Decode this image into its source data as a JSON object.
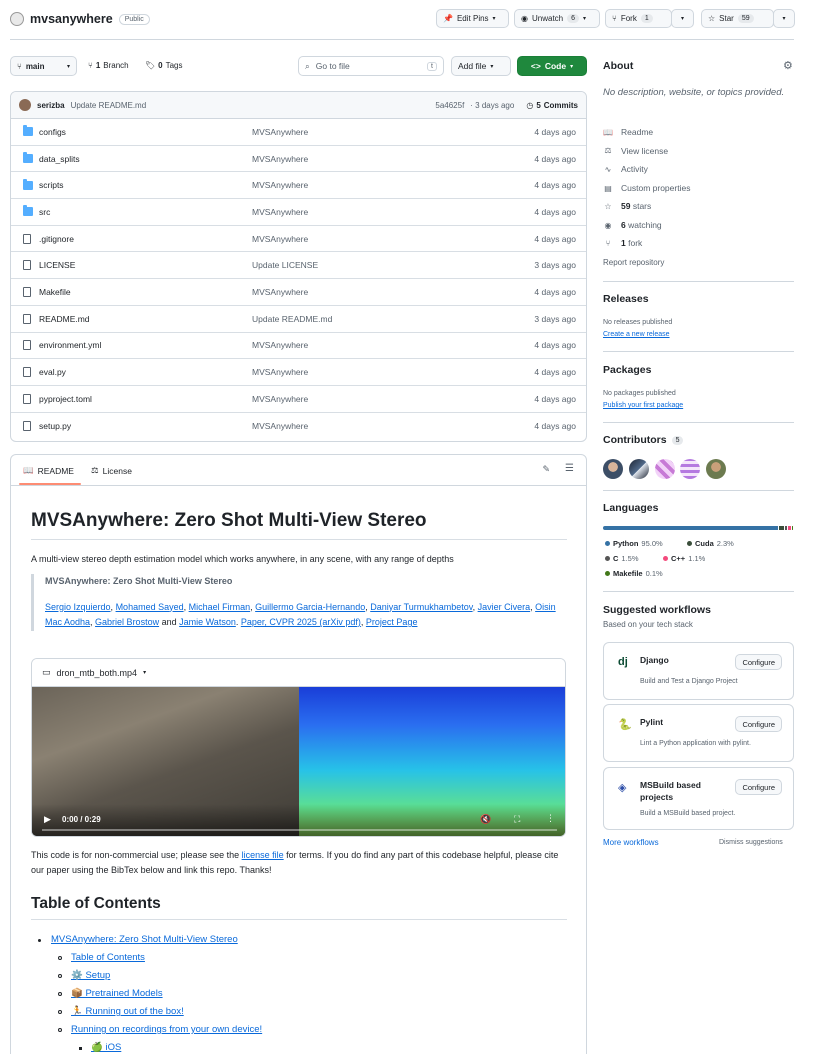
{
  "repo": {
    "name": "mvsanywhere",
    "visibility": "Public"
  },
  "header_buttons": {
    "edit_pins": "Edit Pins",
    "unwatch": "Unwatch",
    "unwatch_count": "6",
    "fork": "Fork",
    "fork_count": "1",
    "star": "Star",
    "star_count": "59"
  },
  "toolbar": {
    "branch": "main",
    "branches_count": "1",
    "branches_label": "Branch",
    "tags_count": "0",
    "tags_label": "Tags",
    "goto_placeholder": "Go to file",
    "goto_key": "t",
    "add_file": "Add file",
    "code": "Code"
  },
  "commit": {
    "author": "serizba",
    "message": "Update README.md",
    "hash": "5a4625f",
    "time": "· 3 days ago",
    "commits_count": "5",
    "commits_label": "Commits"
  },
  "files": [
    {
      "name": "configs",
      "type": "folder",
      "commit": "MVSAnywhere",
      "time": "4 days ago"
    },
    {
      "name": "data_splits",
      "type": "folder",
      "commit": "MVSAnywhere",
      "time": "4 days ago"
    },
    {
      "name": "scripts",
      "type": "folder",
      "commit": "MVSAnywhere",
      "time": "4 days ago"
    },
    {
      "name": "src",
      "type": "folder",
      "commit": "MVSAnywhere",
      "time": "4 days ago"
    },
    {
      "name": ".gitignore",
      "type": "file",
      "commit": "MVSAnywhere",
      "time": "4 days ago"
    },
    {
      "name": "LICENSE",
      "type": "file",
      "commit": "Update LICENSE",
      "time": "3 days ago"
    },
    {
      "name": "Makefile",
      "type": "file",
      "commit": "MVSAnywhere",
      "time": "4 days ago"
    },
    {
      "name": "README.md",
      "type": "file",
      "commit": "Update README.md",
      "time": "3 days ago"
    },
    {
      "name": "environment.yml",
      "type": "file",
      "commit": "MVSAnywhere",
      "time": "4 days ago"
    },
    {
      "name": "eval.py",
      "type": "file",
      "commit": "MVSAnywhere",
      "time": "4 days ago"
    },
    {
      "name": "pyproject.toml",
      "type": "file",
      "commit": "MVSAnywhere",
      "time": "4 days ago"
    },
    {
      "name": "setup.py",
      "type": "file",
      "commit": "MVSAnywhere",
      "time": "4 days ago"
    }
  ],
  "readme": {
    "tab_readme": "README",
    "tab_license": "License",
    "title": "MVSAnywhere: Zero Shot Multi-View Stereo",
    "intro": "A multi-view stereo depth estimation model which works anywhere, in any scene, with any range of depths",
    "quote_title": "MVSAnywhere: Zero Shot Multi-View Stereo",
    "authors": [
      "Sergio Izquierdo",
      "Mohamed Sayed",
      "Michael Firman",
      "Guillermo Garcia-Hernando",
      "Daniyar Turmukhambetov",
      "Javier Civera",
      "Oisin Mac Aodha",
      "Gabriel Brostow",
      "Jamie Watson"
    ],
    "and": "and",
    "paper_link": "Paper, CVPR 2025 (arXiv pdf)",
    "project_page": "Project Page",
    "video_name": "dron_mtb_both.mp4",
    "video_time": "0:00 / 0:29",
    "license_text_before": "This code is for non-commercial use; please see the",
    "license_link": "license file",
    "license_text_after": "for terms. If you do find any part of this codebase helpful, please cite our paper using the BibTex below and link this repo. Thanks!",
    "toc_heading": "Table of Contents",
    "toc": {
      "root": "MVSAnywhere: Zero Shot Multi-View Stereo",
      "items": [
        "Table of Contents",
        "⚙️ Setup",
        "📦 Pretrained Models",
        "🏃 Running out of the box!",
        "Running on recordings from your own device!"
      ],
      "sub": [
        "🍏 iOS"
      ]
    }
  },
  "about": {
    "heading": "About",
    "description": "No description, website, or topics provided.",
    "items": [
      "Readme",
      "View license",
      "Activity",
      "Custom properties"
    ],
    "stars": "59",
    "stars_label": "stars",
    "watching": "6",
    "watching_label": "watching",
    "forks": "1",
    "forks_label": "fork",
    "report": "Report repository"
  },
  "releases": {
    "heading": "Releases",
    "none": "No releases published",
    "create": "Create a new release"
  },
  "packages": {
    "heading": "Packages",
    "none": "No packages published",
    "publish": "Publish your first package"
  },
  "contributors": {
    "heading": "Contributors",
    "count": "5"
  },
  "languages": {
    "heading": "Languages",
    "list": [
      {
        "name": "Python",
        "pct": "95.0%",
        "value": 95.0,
        "color": "#3572A5"
      },
      {
        "name": "Cuda",
        "pct": "2.3%",
        "value": 2.3,
        "color": "#3A4E3A"
      },
      {
        "name": "C",
        "pct": "1.5%",
        "value": 1.5,
        "color": "#555555"
      },
      {
        "name": "C++",
        "pct": "1.1%",
        "value": 1.1,
        "color": "#f34b7d"
      },
      {
        "name": "Makefile",
        "pct": "0.1%",
        "value": 0.1,
        "color": "#427819"
      }
    ]
  },
  "workflows": {
    "heading": "Suggested workflows",
    "sub": "Based on your tech stack",
    "items": [
      {
        "name": "Django",
        "desc": "Build and Test a Django Project",
        "button": "Configure"
      },
      {
        "name": "Pylint",
        "desc": "Lint a Python application with pylint.",
        "button": "Configure"
      },
      {
        "name": "MSBuild based projects",
        "desc": "Build a MSBuild based project.",
        "button": "Configure"
      }
    ],
    "more": "More workflows",
    "dismiss": "Dismiss suggestions"
  }
}
